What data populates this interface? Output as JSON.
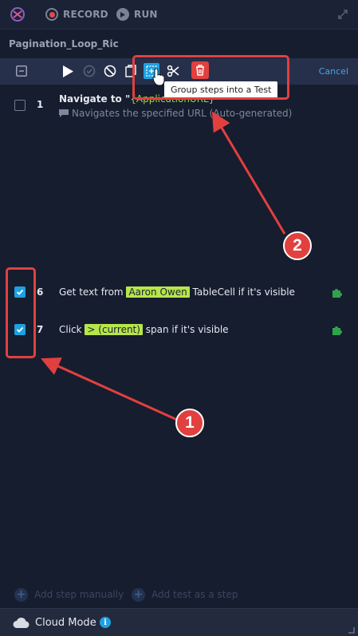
{
  "topbar": {
    "record_label": "RECORD",
    "run_label": "RUN"
  },
  "test_name": "Pagination_Loop_Ric",
  "toolbar": {
    "cancel_label": "Cancel",
    "tools": [
      "select-all-checkbox-icon",
      "play-icon",
      "check-circle-icon",
      "disable-icon",
      "copy-icon",
      "group-into-test-icon",
      "scissors-icon",
      "trash-icon"
    ]
  },
  "tooltip": "Group steps into a Test",
  "steps": [
    {
      "number": "1",
      "title_prefix": "Navigate to \"",
      "title_highlight": "{ApplicationURL}",
      "description": "Navigates the specified URL (Auto-generated)",
      "checked": false
    },
    {
      "number": "6",
      "title_prefix": "Get text from",
      "title_highlight": "Aaron Owen",
      "title_suffix": "TableCell if it's visible",
      "checked": true
    },
    {
      "number": "7",
      "title_prefix": "Click",
      "title_highlight": "> (current)",
      "title_suffix": "span if it's visible",
      "checked": true
    }
  ],
  "bottom": {
    "add_step_label": "Add step manually",
    "add_test_label": "Add test as a step"
  },
  "footer": {
    "mode_label": "Cloud Mode",
    "info_glyph": "i"
  },
  "annotations": {
    "badge_1": "1",
    "badge_2": "2"
  },
  "colors": {
    "background": "#161d2f",
    "accent": "#1da1e2",
    "highlight": "#b7e64a",
    "annotation": "#e2403f",
    "delete": "#e2403f"
  }
}
